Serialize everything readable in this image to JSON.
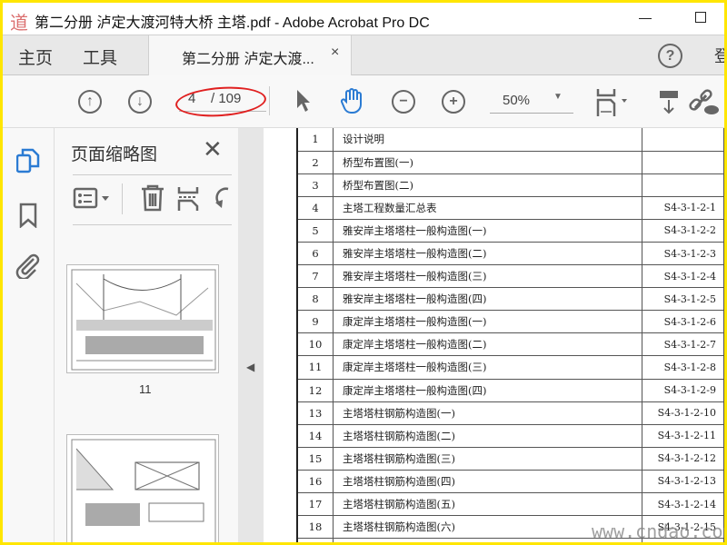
{
  "window": {
    "title": "第二分册 泸定大渡河特大桥 主塔.pdf - Adobe Acrobat Pro DC",
    "app_icon_text": "道"
  },
  "tabs": {
    "home": "主页",
    "tools": "工具",
    "document": "第二分册 泸定大渡...",
    "close": "×",
    "help": "?",
    "signin": "登"
  },
  "toolbar": {
    "page_current": "4",
    "page_total": "/ 109",
    "zoom": "50%"
  },
  "panel": {
    "title": "页面缩略图",
    "close": "✕",
    "thumbnails": [
      {
        "label": "11"
      },
      {
        "label": ""
      }
    ]
  },
  "table": {
    "rows": [
      [
        "1",
        "设计说明",
        ""
      ],
      [
        "2",
        "桥型布置图(一)",
        ""
      ],
      [
        "3",
        "桥型布置图(二)",
        ""
      ],
      [
        "4",
        "主塔工程数量汇总表",
        "S4-3-1-2-1"
      ],
      [
        "5",
        "雅安岸主塔塔柱一般构造图(一)",
        "S4-3-1-2-2"
      ],
      [
        "6",
        "雅安岸主塔塔柱一般构造图(二)",
        "S4-3-1-2-3"
      ],
      [
        "7",
        "雅安岸主塔塔柱一般构造图(三)",
        "S4-3-1-2-4"
      ],
      [
        "8",
        "雅安岸主塔塔柱一般构造图(四)",
        "S4-3-1-2-5"
      ],
      [
        "9",
        "康定岸主塔塔柱一般构造图(一)",
        "S4-3-1-2-6"
      ],
      [
        "10",
        "康定岸主塔塔柱一般构造图(二)",
        "S4-3-1-2-7"
      ],
      [
        "11",
        "康定岸主塔塔柱一般构造图(三)",
        "S4-3-1-2-8"
      ],
      [
        "12",
        "康定岸主塔塔柱一般构造图(四)",
        "S4-3-1-2-9"
      ],
      [
        "13",
        "主塔塔柱钢筋构造图(一)",
        "S4-3-1-2-10"
      ],
      [
        "14",
        "主塔塔柱钢筋构造图(二)",
        "S4-3-1-2-11"
      ],
      [
        "15",
        "主塔塔柱钢筋构造图(三)",
        "S4-3-1-2-12"
      ],
      [
        "16",
        "主塔塔柱钢筋构造图(四)",
        "S4-3-1-2-13"
      ],
      [
        "17",
        "主塔塔柱钢筋构造图(五)",
        "S4-3-1-2-14"
      ],
      [
        "18",
        "主塔塔柱钢筋构造图(六)",
        "S4-3-1-2-15"
      ],
      [
        "",
        "",
        ""
      ]
    ]
  },
  "watermark": "www.cndao.com",
  "colors": {
    "frame": "#ffe600",
    "accent": "#2b7bd3",
    "annotation": "#e02020"
  }
}
